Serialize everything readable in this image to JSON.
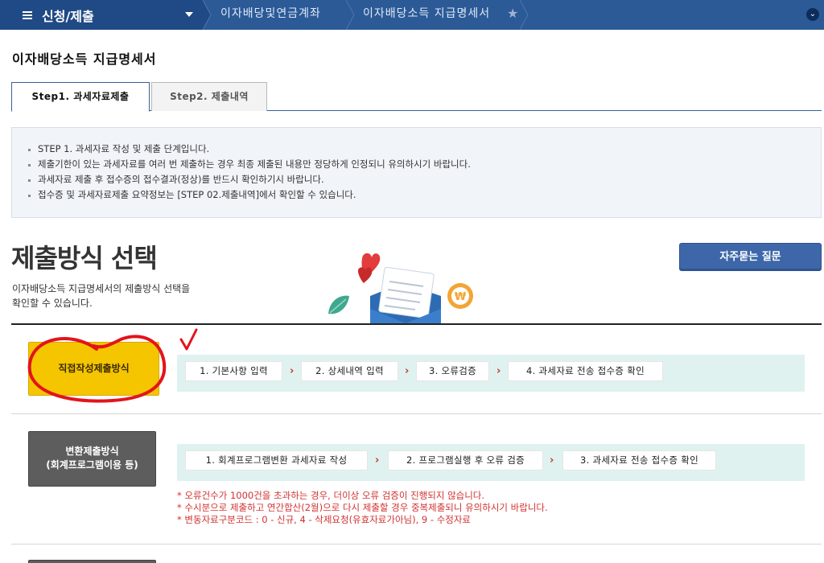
{
  "topbar": {
    "menu_title": "신청/제출",
    "breadcrumbs": [
      "이자배당및연금계좌",
      "이자배당소득 지급명세서"
    ],
    "favorite_icon": "star-icon",
    "dropdown_icon": "chevron-down-icon"
  },
  "page_title": "이자배당소득 지급명세서",
  "tabs": [
    {
      "label": "Step1. 과세자료제출",
      "active": true
    },
    {
      "label": "Step2. 제출내역",
      "active": false
    }
  ],
  "info": [
    "STEP 1. 과세자료 작성 및 제출 단계입니다.",
    "제출기한이 있는 과세자료를 여러 번 제출하는 경우 최종 제출된 내용만 정당하게 인정되니 유의하시기 바랍니다.",
    "과세자료 제출 후 접수증의 접수결과(정상)를 반드시 확인하기시 바랍니다.",
    "접수증 및 과세자료제출 요약정보는 [STEP 02.제출내역]에서 확인할 수 있습니다."
  ],
  "section": {
    "title": "제출방식 선택",
    "desc_line1": "이자배당소득 지급명세서의 제출방식 선택을",
    "desc_line2": "확인할 수 있습니다.",
    "faq_label": "자주묻는 질문"
  },
  "methods": {
    "direct": {
      "label": "직접작성제출방식",
      "steps": [
        "1. 기본사항 입력",
        "2. 상세내역 입력",
        "3. 오류검증",
        "4. 과세자료 전송 접수증 확인"
      ]
    },
    "convert": {
      "label_line1": "변환제출방식",
      "label_line2": "(회계프로그램이용 등)",
      "steps": [
        "1. 회계프로그램변환 과세자료 작성",
        "2. 프로그램실행 후 오류 검증",
        "3. 과세자료 전송 접수증 확인"
      ],
      "notes": [
        "* 오류건수가 1000건을 초과하는 경우, 더이상 오류 검증이 진행되지 않습니다.",
        "* 수시분으로 제출하고 연간합산(2월)으로 다시 제출할 경우 중복제출되니 유의하시기 바랍니다.",
        "* 변동자료구분코드 : 0 - 신규, 4 - 삭제요청(유효자료가아님), 9 - 수정자료"
      ]
    }
  },
  "colors": {
    "topbar": "#2b5a97",
    "direct_button": "#f5c500",
    "convert_button": "#5d5d5d",
    "steps_band": "#dff2f0",
    "note_red": "#d23131",
    "annotation_red": "#e2141b"
  }
}
